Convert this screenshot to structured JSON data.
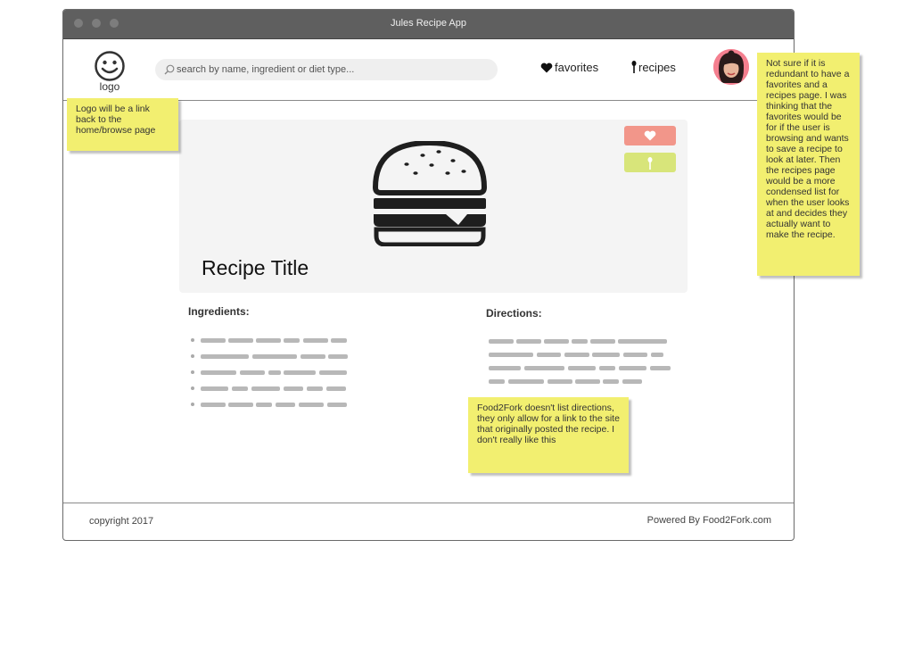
{
  "window": {
    "title": "Jules Recipe App"
  },
  "header": {
    "logo_label": "logo",
    "search_placeholder": "search by name, ingredient or diet type...",
    "nav": {
      "favorites": "favorites",
      "recipes": "recipes"
    }
  },
  "recipe": {
    "title": "Recipe Title",
    "ingredients_label": "Ingredients:",
    "directions_label": "Directions:"
  },
  "footer": {
    "copyright": "copyright 2017",
    "powered_by": "Powered By Food2Fork.com"
  },
  "annotations": {
    "logo_note": "Logo will be a link back to the home/browse page",
    "favorites_note": "Not sure if it is redundant to have a favorites and a recipes page.  I was thinking that the favorites would be for if the user is browsing and wants to save a recipe to look at later. Then the recipes page would be a more condensed list for when the user looks at and decides they actually want to make the recipe.",
    "directions_note": "Food2Fork doesn't list directions, they only allow for a link to the site that originally posted the recipe. I don't really like this"
  },
  "colors": {
    "favorite_button": "#f2968a",
    "recipe_button": "#d8e57a",
    "sticky_note": "#f2ef70",
    "titlebar": "#5f5f5f"
  }
}
